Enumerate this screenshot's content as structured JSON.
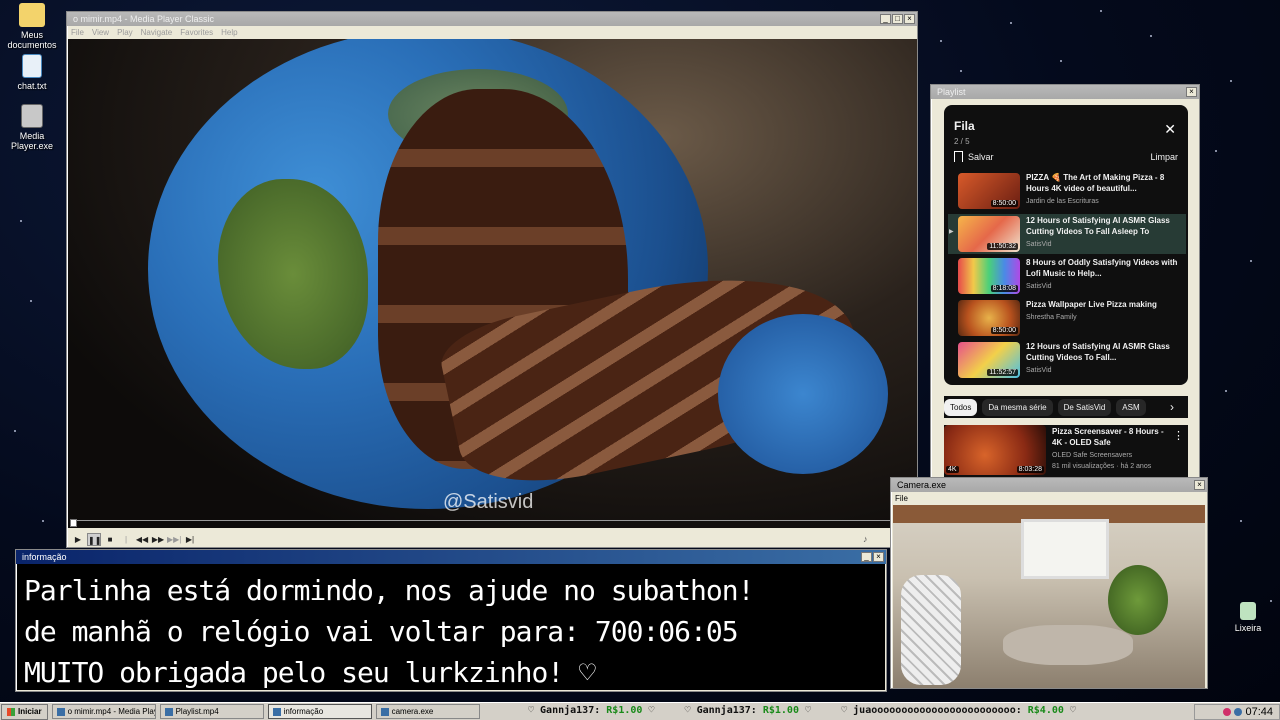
{
  "desktop": {
    "icons": [
      {
        "label": "Meus documentos"
      },
      {
        "label": "chat.txt"
      },
      {
        "label": "Media Player.exe"
      },
      {
        "label": "Lixeira"
      }
    ]
  },
  "media_player": {
    "title": "o mimir.mp4 - Media Player Classic",
    "menu": [
      "File",
      "View",
      "Play",
      "Navigate",
      "Favorites",
      "Help"
    ],
    "watermark": "@Satisvid",
    "controls": [
      "▶",
      "❚❚",
      "■",
      "|◀◀",
      "◀◀",
      "▶▶",
      "▶▶|",
      "▶|"
    ],
    "volume_icon": "♪"
  },
  "playlist_window": {
    "title": "Playlist",
    "header": "Fila",
    "count": "2 / 5",
    "save_label": "Salvar",
    "clear_label": "Limpar",
    "close_glyph": "✕",
    "items": [
      {
        "title": "PIZZA 🍕 The Art of Making Pizza - 8 Hours 4K video of beautiful...",
        "channel": "Jardin de las Escrituras",
        "duration": "8:50:00",
        "thumb_color": "#b3432a"
      },
      {
        "title": "12 Hours of Satisfying AI ASMR Glass Cutting Videos To Fall Asleep To",
        "channel": "SatisVid",
        "duration": "11:50:32",
        "thumb_color": "#e88a3a"
      },
      {
        "title": "8 Hours of Oddly Satisfying Videos with Lofi Music to Help...",
        "channel": "SatisVid",
        "duration": "8:18:08",
        "thumb_color": "#8a5ad0"
      },
      {
        "title": "Pizza Wallpaper Live Pizza making",
        "channel": "Shrestha Family",
        "duration": "8:50:00",
        "thumb_color": "#c96a2a"
      },
      {
        "title": "12 Hours of Satisfying AI ASMR Glass Cutting Videos To Fall...",
        "channel": "SatisVid",
        "duration": "11:52:57",
        "thumb_color": "#d04a8a"
      }
    ],
    "chips": [
      "Todos",
      "Da mesma série",
      "De SatisVid",
      "ASM"
    ],
    "chip_next": "›",
    "recommendation": {
      "title": "Pizza Screensaver - 8 Hours - 4K - OLED Safe",
      "channel": "OLED Safe Screensavers",
      "stats": "81 mil visualizações · há 2 anos",
      "duration": "8:03:28",
      "badge": "4K",
      "more": "⋮"
    }
  },
  "info_window": {
    "title": "informação",
    "lines": [
      "Parlinha está dormindo, nos ajude no subathon!",
      "de manhã o relógio vai voltar para:  700:06:05",
      "MUITO obrigada pelo seu lurkzinho! ♡"
    ]
  },
  "camera_window": {
    "title": "Camera.exe",
    "menu": [
      "File"
    ]
  },
  "taskbar": {
    "start_label": "Iniciar",
    "tasks": [
      {
        "label": "o mimir.mp4 - Media Playe..."
      },
      {
        "label": "Playlist.mp4"
      },
      {
        "label": "informação"
      },
      {
        "label": "camera.exe"
      }
    ],
    "ticker": [
      {
        "user": "♡ Gannja137: ",
        "amount": "R$1.00",
        "tail": " ♡"
      },
      {
        "user": "♡ Gannja137: ",
        "amount": "R$1.00",
        "tail": " ♡"
      },
      {
        "user": "♡ juaoooooooooooooooooooooooo: ",
        "amount": "R$4.00",
        "tail": " ♡"
      }
    ],
    "clock": "07:44"
  }
}
